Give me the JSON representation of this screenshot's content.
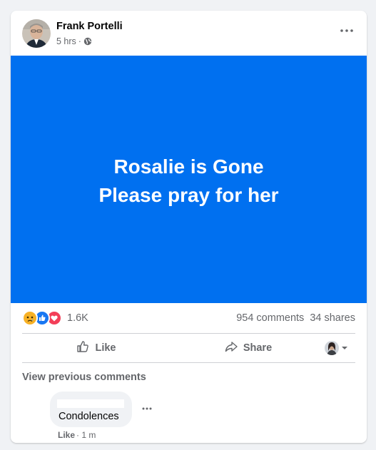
{
  "post": {
    "author": "Frank Portelli",
    "time": "5 hrs",
    "separator": "·",
    "privacy_icon": "globe-icon",
    "image_text_line1": "Rosalie is Gone",
    "image_text_line2": "Please pray for her",
    "image_bg_color": "#0070f0"
  },
  "stats": {
    "reaction_icons": [
      "sad-reaction-icon",
      "like-reaction-icon",
      "love-reaction-icon"
    ],
    "reaction_count": "1.6K",
    "comments": "954 comments",
    "shares": "34 shares"
  },
  "actions": {
    "like_label": "Like",
    "share_label": "Share"
  },
  "comments": {
    "view_previous": "View previous comments",
    "items": [
      {
        "author": "",
        "text": "Condolences",
        "like_label": "Like",
        "time": "· 1 m"
      }
    ]
  },
  "colors": {
    "brand_blue": "#1877f2",
    "muted_text": "#65676b",
    "background": "#f0f2f5"
  }
}
